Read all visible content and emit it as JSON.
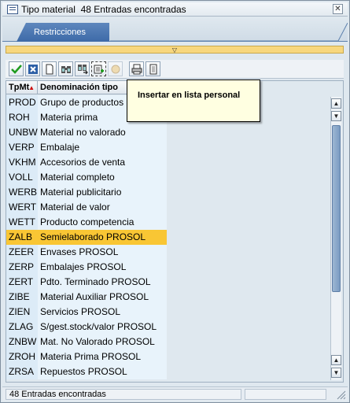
{
  "window": {
    "title": "Tipo material",
    "count_label": "48 Entradas encontradas"
  },
  "tabs": [
    {
      "label": "Restricciones"
    }
  ],
  "toolbar": {
    "buttons": [
      {
        "icon": "check-icon"
      },
      {
        "icon": "cancel-icon"
      },
      {
        "icon": "new-document-icon"
      },
      {
        "icon": "find-icon"
      },
      {
        "icon": "find-next-icon"
      },
      {
        "icon": "insert-personal-list-icon"
      },
      {
        "icon": "personal-list-icon"
      },
      {
        "icon": "print-icon"
      },
      {
        "icon": "info-icon"
      }
    ]
  },
  "tooltip": {
    "text": "Insertar en lista personal"
  },
  "table": {
    "columns": [
      "TpMt",
      "Denominación tipo"
    ],
    "rows": [
      {
        "code": "PROD",
        "desc": "Grupo de productos"
      },
      {
        "code": "ROH",
        "desc": "Materia prima"
      },
      {
        "code": "UNBW",
        "desc": "Material no valorado"
      },
      {
        "code": "VERP",
        "desc": "Embalaje"
      },
      {
        "code": "VKHM",
        "desc": "Accesorios de venta"
      },
      {
        "code": "VOLL",
        "desc": "Material completo"
      },
      {
        "code": "WERB",
        "desc": "Material publicitario"
      },
      {
        "code": "WERT",
        "desc": "Material de valor"
      },
      {
        "code": "WETT",
        "desc": "Producto competencia"
      },
      {
        "code": "ZALB",
        "desc": "Semielaborado PROSOL"
      },
      {
        "code": "ZEER",
        "desc": "Envases PROSOL"
      },
      {
        "code": "ZERP",
        "desc": "Embalajes PROSOL"
      },
      {
        "code": "ZERT",
        "desc": "Pdto. Terminado PROSOL"
      },
      {
        "code": "ZIBE",
        "desc": "Material Auxiliar PROSOL"
      },
      {
        "code": "ZIEN",
        "desc": "Servicios PROSOL"
      },
      {
        "code": "ZLAG",
        "desc": "S/gest.stock/valor PROSOL"
      },
      {
        "code": "ZNBW",
        "desc": "Mat. No Valorado PROSOL"
      },
      {
        "code": "ZROH",
        "desc": "Materia Prima PROSOL"
      },
      {
        "code": "ZRSA",
        "desc": "Repuestos PROSOL"
      }
    ],
    "selected_code": "ZALB"
  },
  "status": {
    "text": "48 Entradas encontradas"
  },
  "colors": {
    "selection": "#f9c634",
    "tab": "#4a76b0",
    "expander": "#f7d77e"
  }
}
